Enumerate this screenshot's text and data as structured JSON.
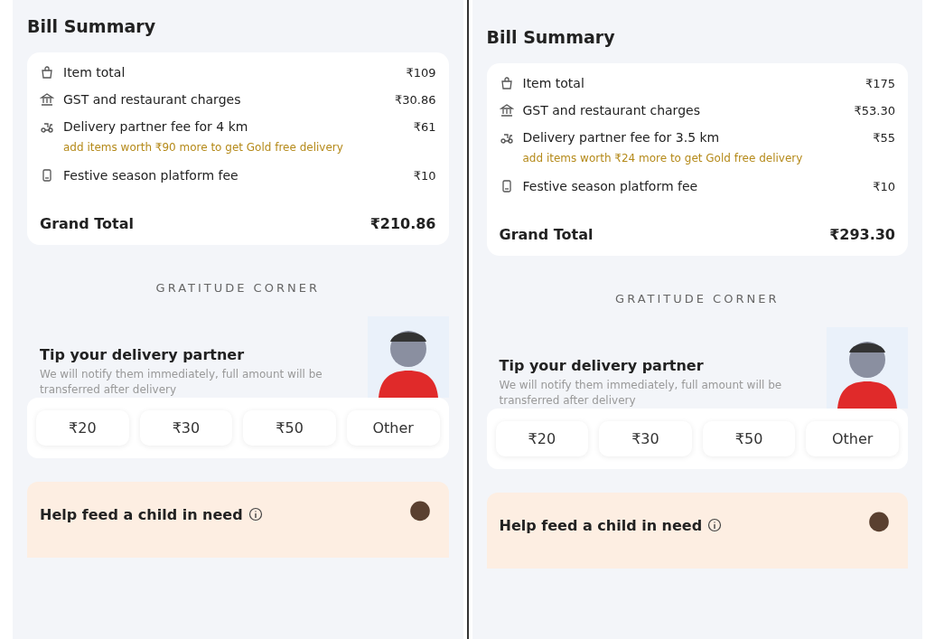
{
  "panels": [
    {
      "title": "Bill Summary",
      "items": [
        {
          "kind": "bag",
          "label": "Item total",
          "amount": "₹109"
        },
        {
          "kind": "bank",
          "label": "GST and restaurant charges",
          "amount": "₹30.86"
        },
        {
          "kind": "scooter",
          "label": "Delivery partner fee for 4 km",
          "amount": "₹61",
          "note": "add items worth ₹90 more to get Gold free delivery"
        },
        {
          "kind": "receipt",
          "label": "Festive season platform fee",
          "amount": "₹10"
        }
      ],
      "grand_total_label": "Grand Total",
      "grand_total": "₹210.86",
      "section_heading": "GRATITUDE CORNER",
      "tip": {
        "title": "Tip your delivery partner",
        "description": "We will notify them immediately, full amount will be transferred after delivery",
        "options": [
          {
            "label": "₹20"
          },
          {
            "label": "₹30"
          },
          {
            "label": "₹50"
          },
          {
            "label": "Other"
          }
        ]
      },
      "donation": {
        "title": "Help feed a child in need"
      }
    },
    {
      "title": "Bill Summary",
      "items": [
        {
          "kind": "bag",
          "label": "Item total",
          "amount": "₹175"
        },
        {
          "kind": "bank",
          "label": "GST and restaurant charges",
          "amount": "₹53.30"
        },
        {
          "kind": "scooter",
          "label": "Delivery partner fee for 3.5 km",
          "amount": "₹55",
          "note": "add items worth ₹24 more to get Gold free delivery"
        },
        {
          "kind": "receipt",
          "label": "Festive season platform fee",
          "amount": "₹10"
        }
      ],
      "grand_total_label": "Grand Total",
      "grand_total": "₹293.30",
      "section_heading": "GRATITUDE CORNER",
      "tip": {
        "title": "Tip your delivery partner",
        "description": "We will notify them immediately, full amount will be transferred after delivery",
        "options": [
          {
            "label": "₹20"
          },
          {
            "label": "₹30"
          },
          {
            "label": "₹50"
          },
          {
            "label": "Other"
          }
        ]
      },
      "donation": {
        "title": "Help feed a child in need"
      }
    }
  ]
}
